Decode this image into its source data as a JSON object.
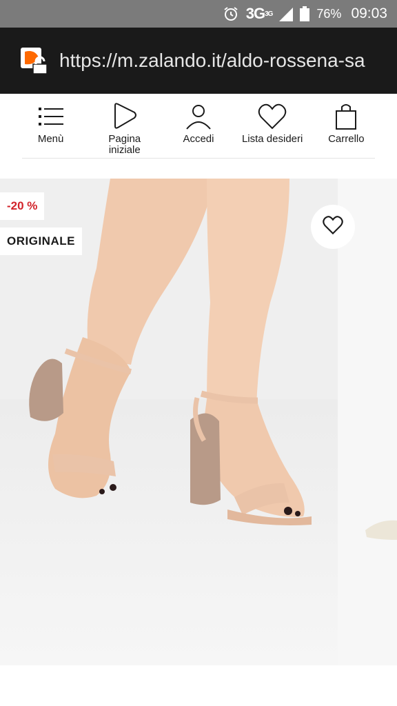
{
  "status_bar": {
    "icons": [
      "alarm-icon",
      "signal-icon",
      "battery-icon"
    ],
    "network": "3G",
    "network_sup": "3G",
    "battery": "76%",
    "time": "09:03"
  },
  "browser": {
    "url": "https://m.zalando.it/aldo-rossena-sa",
    "site_icon": "zalando-lock-icon",
    "site_icon_color": "#ff6900"
  },
  "nav": {
    "items": [
      {
        "icon": "menu-icon",
        "label": "Menù"
      },
      {
        "icon": "home-logo-icon",
        "label": "Pagina\niniziale"
      },
      {
        "icon": "user-icon",
        "label": "Accedi"
      },
      {
        "icon": "heart-icon",
        "label": "Lista desideri"
      },
      {
        "icon": "bag-icon",
        "label": "Carrello"
      }
    ]
  },
  "product": {
    "discount_badge": "-20 %",
    "original_badge": "ORIGINALE",
    "wishlist_icon": "heart-icon",
    "image_subject": "product-photo",
    "colors": {
      "discount": "#d2232a",
      "skin": "#f0c9ad",
      "strap": "#eac3a8",
      "glitter": "#b89a88"
    }
  }
}
